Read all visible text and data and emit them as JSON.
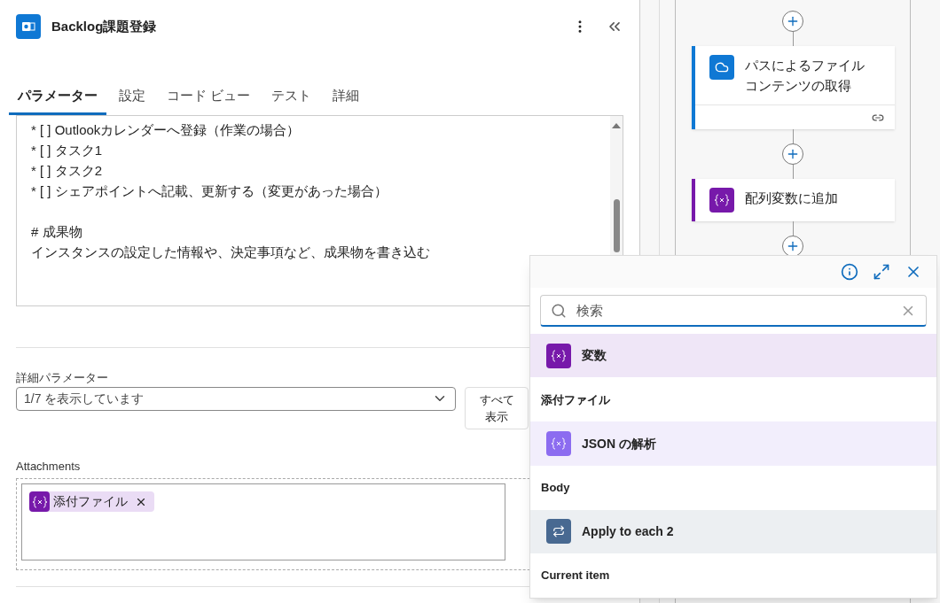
{
  "panel": {
    "title": "Backlog課題登録",
    "tabs": [
      {
        "label": "パラメーター",
        "selected": true
      },
      {
        "label": "設定",
        "selected": false
      },
      {
        "label": "コード ビュー",
        "selected": false
      },
      {
        "label": "テスト",
        "selected": false
      },
      {
        "label": "詳細",
        "selected": false
      }
    ],
    "body_blocks": [
      [
        "* [ ] Outlookカレンダーへ登録（作業の場合）",
        "* [ ] タスク1",
        "* [ ] タスク2",
        "* [ ] シェアポイントへ記載、更新する（変更があった場合）"
      ],
      [
        "# 成果物",
        "インスタンスの設定した情報や、決定事項など、成果物を書き込む"
      ]
    ],
    "advanced": {
      "label": "詳細パラメーター",
      "value": "1/7 を表示しています",
      "button": "すべて表示"
    },
    "attachments": {
      "label": "Attachments",
      "token": "添付ファイル"
    }
  },
  "canvas": {
    "nodes": [
      {
        "title": "パスによるファイルコンテンツの取得",
        "kind": "cloud"
      },
      {
        "title": "配列変数に追加",
        "kind": "variable"
      }
    ]
  },
  "popup": {
    "search": {
      "placeholder": "検索"
    },
    "groups": [
      {
        "source": "変数",
        "kind": "variable",
        "item": "添付ファイル"
      },
      {
        "source": "JSON の解析",
        "kind": "json",
        "item": "Body"
      },
      {
        "source": "Apply to each 2",
        "kind": "loop",
        "item": "Current item"
      }
    ]
  }
}
